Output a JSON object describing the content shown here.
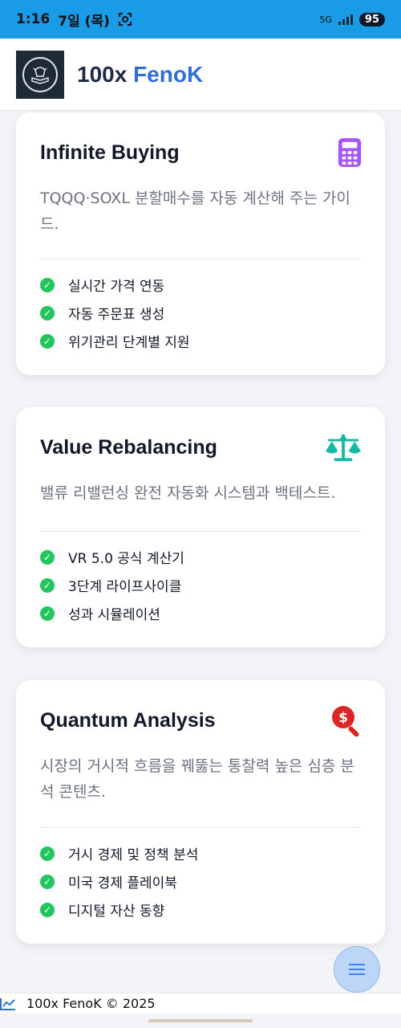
{
  "status_bar": {
    "time": "1:16",
    "date": "7일 (목)",
    "network": "5G",
    "battery": "95"
  },
  "header": {
    "brand_prefix": "100x ",
    "brand_accent": "FenoK"
  },
  "cards": [
    {
      "title": "Infinite Buying",
      "icon": "calculator-icon",
      "icon_color": "#a855f7",
      "description": "TQQQ·SOXL 분할매수를 자동 계산해 주는 가이드.",
      "features": [
        "실시간 가격 연동",
        "자동 주문표 생성",
        "위기관리 단계별 지원"
      ]
    },
    {
      "title": "Value Rebalancing",
      "icon": "balance-scale-icon",
      "icon_color": "#14b8a6",
      "description": "밸류 리밸런싱 완전 자동화 시스템과 백테스트.",
      "features": [
        "VR 5.0 공식 계산기",
        "3단계 라이프사이클",
        "성과 시뮬레이션"
      ]
    },
    {
      "title": "Quantum Analysis",
      "icon": "search-dollar-icon",
      "icon_color": "#dc2626",
      "description": "시장의 거시적 흐름을 꿰뚫는 통찰력 높은 심층 분석 콘텐츠.",
      "features": [
        "거시 경제 및 정책 분석",
        "미국 경제 플레이북",
        "디지털 자산 동향"
      ]
    }
  ],
  "footer": {
    "text": "100x FenoK © 2025"
  },
  "colors": {
    "status_bar": "#1a9be6",
    "check": "#22c55e",
    "brand_accent": "#2f6fd6"
  }
}
